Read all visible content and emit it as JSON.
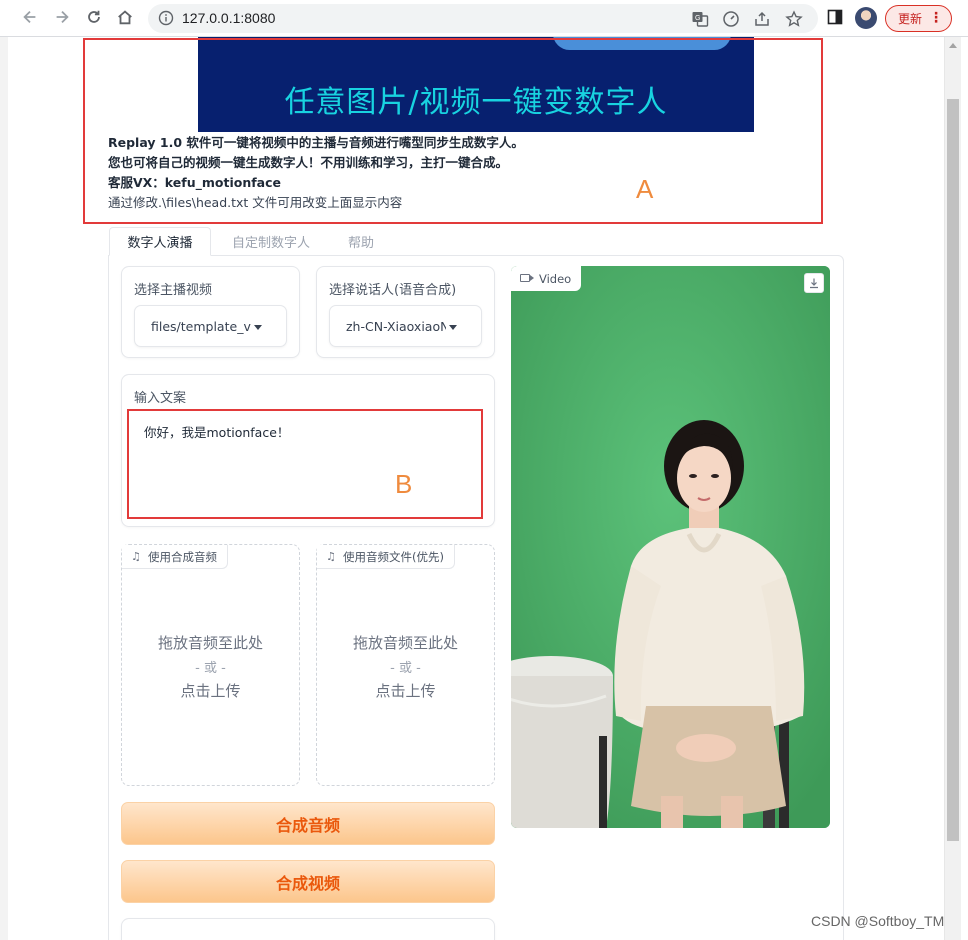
{
  "browser": {
    "url": "127.0.0.1:8080",
    "update_label": "更新",
    "tiny_left": "t"
  },
  "header": {
    "banner_text": "任意图片/视频一键变数字人",
    "lines": [
      "Replay 1.0 软件可一键将视频中的主播与音频进行嘴型同步生成数字人。",
      "您也可将自己的视频一键生成数字人！不用训练和学习，主打一键合成。",
      "客服VX：kefu_motionface",
      "通过修改.\\files\\head.txt 文件可用改变上面显示内容"
    ]
  },
  "annotations": {
    "a": "A",
    "b": "B"
  },
  "tabs": [
    "数字人演播",
    "自定制数字人",
    "帮助"
  ],
  "form": {
    "video_select": {
      "label": "选择主播视频",
      "value": "files/template_v"
    },
    "speaker_select": {
      "label": "选择说话人(语音合成)",
      "value": "zh-CN-XiaoxiaoN"
    },
    "text_input": {
      "label": "输入文案",
      "value": "你好，我是motionface！"
    },
    "upload_synth": {
      "tag": "使用合成音频",
      "line1": "拖放音频至此处",
      "line2": "- 或 -",
      "line3": "点击上传"
    },
    "upload_file": {
      "tag": "使用音频文件(优先)",
      "line1": "拖放音频至此处",
      "line2": "- 或 -",
      "line3": "点击上传"
    },
    "btn_audio": "合成音频",
    "btn_video": "合成视频"
  },
  "video": {
    "tag": "Video"
  },
  "watermark": "CSDN @Softboy_TM",
  "colors": {
    "accent": "#ea580c",
    "annotation_box": "#e23a3a",
    "annotation_letter": "#ef8b3e",
    "banner_bg": "#07206f",
    "banner_text": "#18d3e0",
    "video_bg": "#4fae6a"
  }
}
